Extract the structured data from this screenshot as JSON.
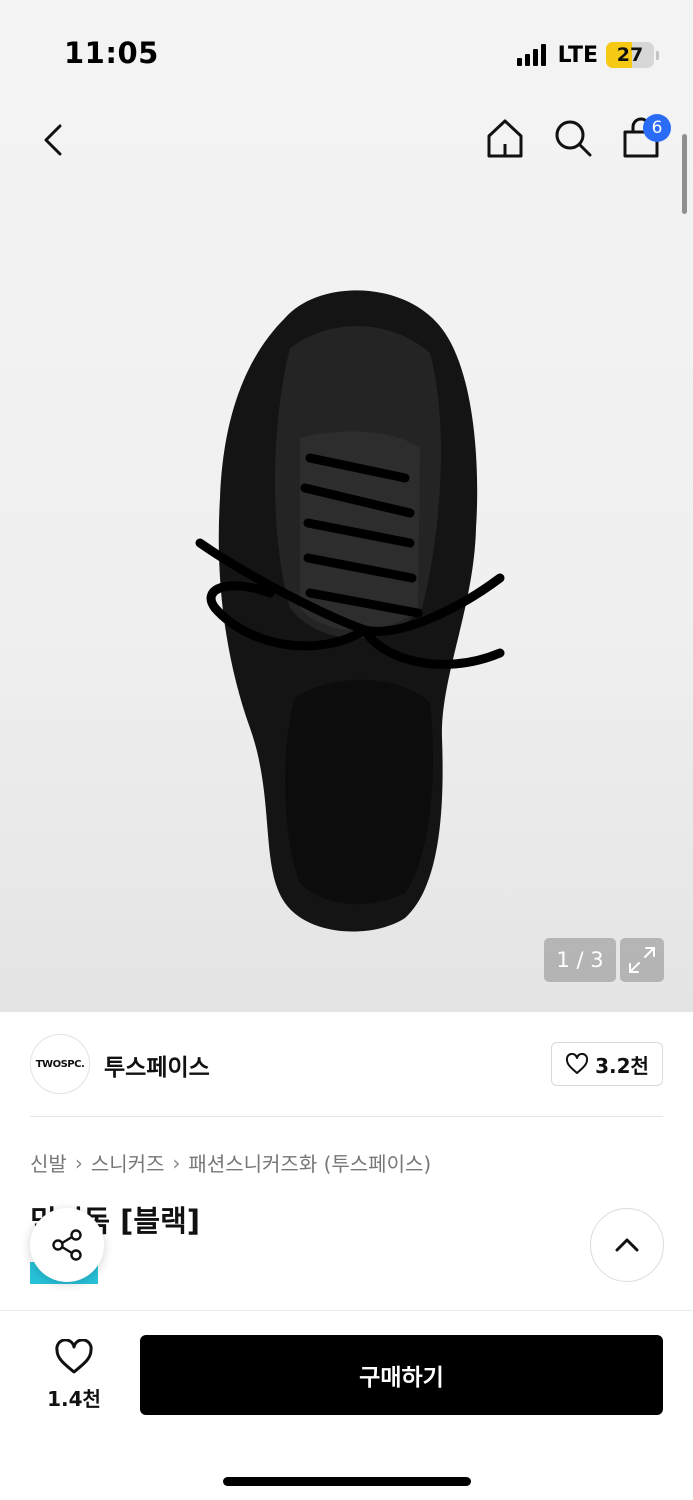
{
  "status_bar": {
    "time": "11:05",
    "network": "LTE",
    "battery": "27",
    "battery_color": "#f6c915"
  },
  "nav": {
    "back_icon": "chevron-left-icon",
    "home_icon": "home-icon",
    "search_icon": "search-icon",
    "cart_icon": "shopping-bag-icon",
    "cart_badge": "6",
    "badge_color": "#2b6cf6"
  },
  "gallery": {
    "counter": "1 / 3",
    "expand_icon": "expand-icon"
  },
  "brand": {
    "logo_text": "TWOSPC.",
    "name": "투스페이스",
    "like_count": "3.2천"
  },
  "breadcrumb": [
    "신발",
    "스니커즈",
    "패션스니커즈화 (투스페이스)"
  ],
  "product": {
    "title": "믹리독 [블랙]",
    "tag_color": "#27c2d9"
  },
  "actions": {
    "share_icon": "share-icon",
    "scroll_top_icon": "chevron-up-icon"
  },
  "bottom_bar": {
    "wish_count": "1.4천",
    "buy_label": "구매하기"
  }
}
